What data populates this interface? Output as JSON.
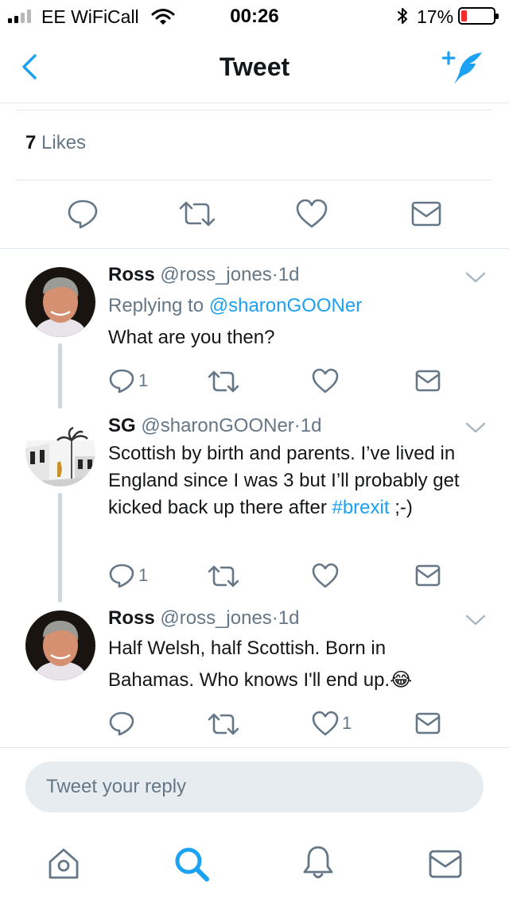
{
  "status_bar": {
    "carrier": "EE WiFiCall",
    "time": "00:26",
    "battery_percent": "17%",
    "battery_level": 0.17,
    "signal_bars_full": 2,
    "signal_bars_total": 4
  },
  "nav": {
    "title": "Tweet",
    "back_icon": "chevron-left-icon",
    "compose_icon": "compose-tweet-icon"
  },
  "tweet": {
    "likes_count": "7",
    "likes_label": "Likes"
  },
  "replies": [
    {
      "name": "Ross",
      "handle": "@ross_jones",
      "sep": "·",
      "time": "1d",
      "replying_prefix": "Replying to",
      "replying_to": "@sharonGOONer",
      "text": "What are you then?",
      "reply_count": "1",
      "like_count": ""
    },
    {
      "name": "SG",
      "handle": "@sharonGOONer",
      "sep": "·",
      "time": "1d",
      "text_before": "Scottish by birth and parents. I’ve lived in England since I was 3 but I’ll probably get kicked back up there after ",
      "hashtag": "#brexit",
      "text_after": " ;-)",
      "reply_count": "1",
      "like_count": ""
    },
    {
      "name": "Ross",
      "handle": "@ross_jones",
      "sep": "·",
      "time": "1d",
      "text": "Half Welsh, half Scottish. Born in Bahamas. Who knows I'll end up.",
      "emoji": "😂",
      "reply_count": "",
      "like_count": "1"
    }
  ],
  "reply_box": {
    "placeholder": "Tweet your reply"
  },
  "tab_bar": {
    "items": [
      "home-icon",
      "search-icon",
      "notifications-icon",
      "messages-icon"
    ],
    "active": "search-icon"
  },
  "colors": {
    "accent": "#1da1f2",
    "secondary_text": "#657786",
    "divider": "#e1e8ed",
    "battery_low": "#f52b2b"
  }
}
